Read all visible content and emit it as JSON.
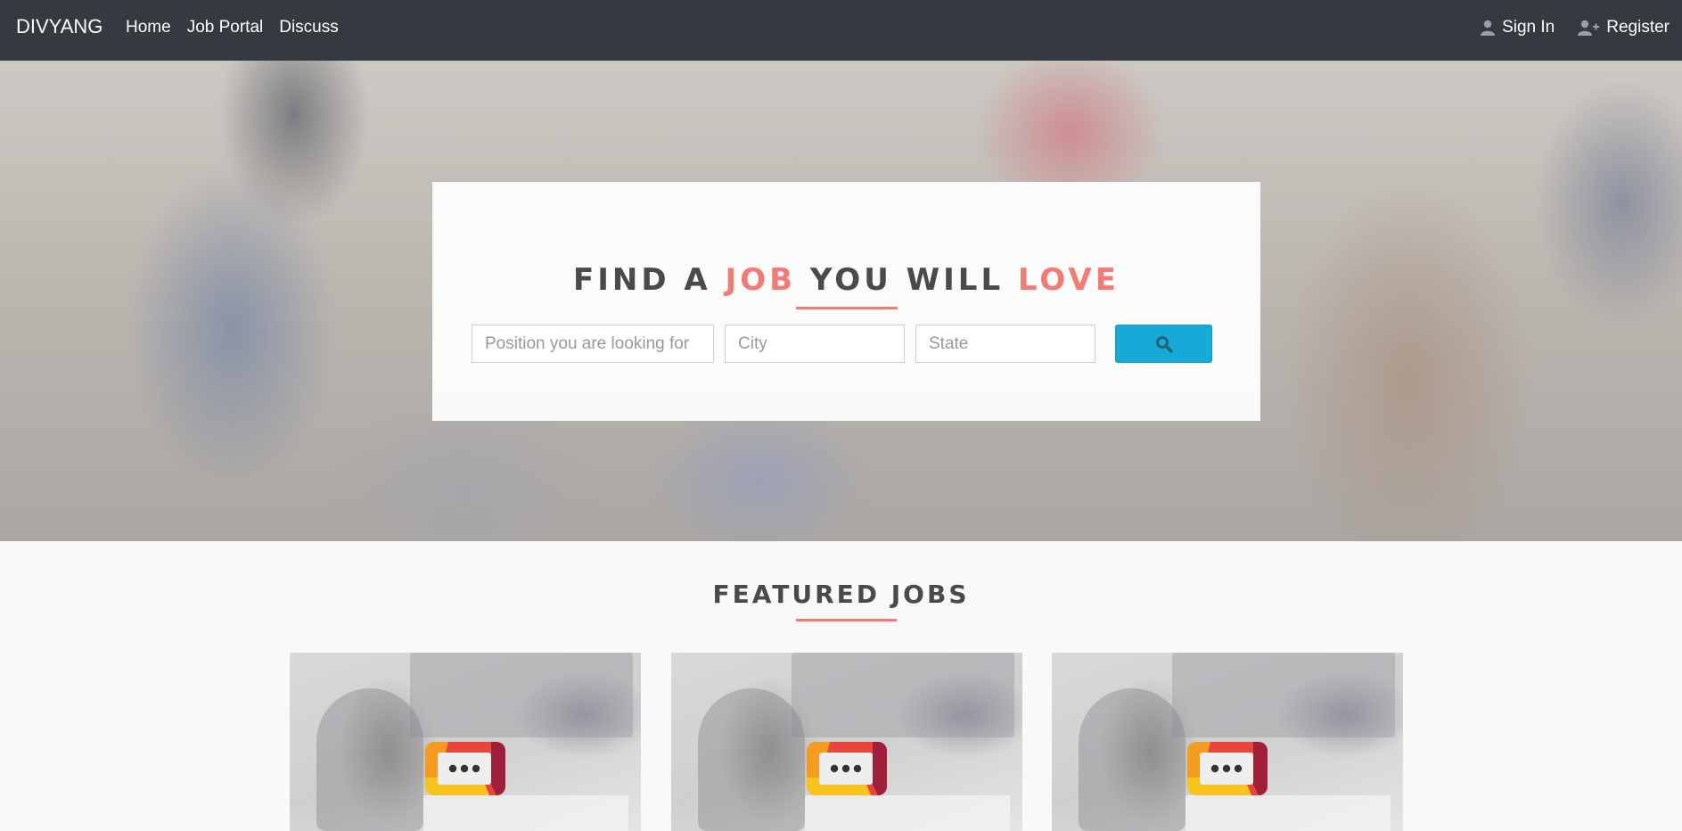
{
  "navbar": {
    "brand": "DIVYANG",
    "links": [
      "Home",
      "Job Portal",
      "Discuss"
    ],
    "sign_in": "Sign In",
    "register": "Register"
  },
  "hero": {
    "title_parts": [
      "FIND A ",
      "JOB",
      " YOU WILL ",
      "LOVE"
    ],
    "search": {
      "position_placeholder": "Position you are looking for",
      "city_placeholder": "City",
      "state_placeholder": "State",
      "button_icon": "search-icon"
    }
  },
  "featured": {
    "title": "FEATURED JOBS",
    "cards": [
      {
        "logo_icon": "chat-bubble-logo-icon"
      },
      {
        "logo_icon": "chat-bubble-logo-icon"
      },
      {
        "logo_icon": "chat-bubble-logo-icon"
      }
    ]
  },
  "colors": {
    "navbar_bg": "#343a40",
    "accent": "#f07b77",
    "search_button": "#17a9d8"
  }
}
